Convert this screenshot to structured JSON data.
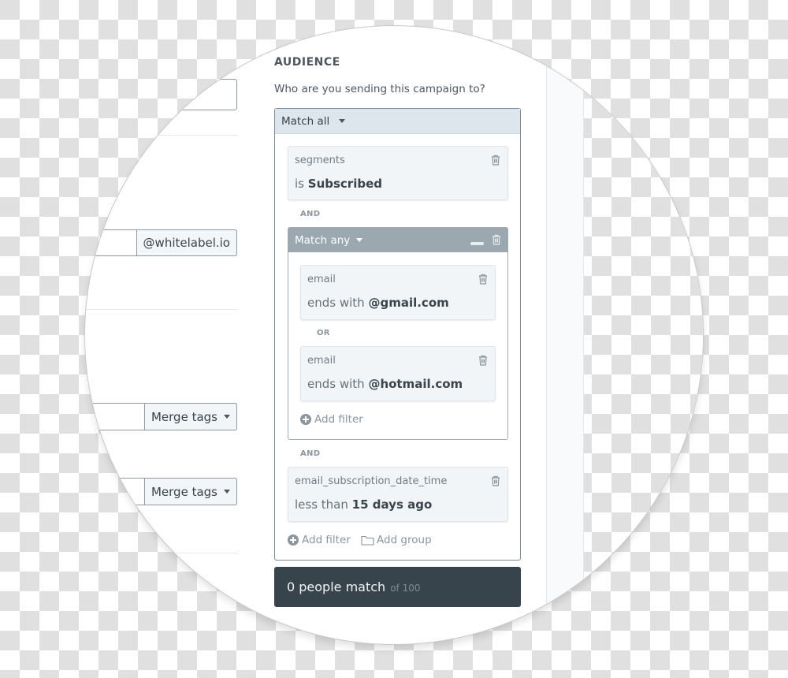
{
  "left_form": {
    "domain_addon": "@whitelabel.io",
    "merge_tags_label_1": "Merge tags",
    "merge_tags_label_2": "Merge tags"
  },
  "audience": {
    "title": "AUDIENCE",
    "subtitle": "Who are you sending this campaign to?",
    "match_mode": "Match all",
    "filters": [
      {
        "field": "segments",
        "operator": "is",
        "value": "Subscribed"
      }
    ],
    "conjunction_1": "AND",
    "group": {
      "match_mode": "Match any",
      "filters": [
        {
          "field": "email",
          "operator": "ends with",
          "value": "@gmail.com"
        },
        {
          "field": "email",
          "operator": "ends with",
          "value": "@hotmail.com"
        }
      ],
      "conjunction": "OR",
      "add_filter_label": "Add filter"
    },
    "conjunction_2": "AND",
    "date_filter": {
      "field": "email_subscription_date_time",
      "operator": "less than",
      "value": "15 days ago"
    },
    "add_filter_label": "Add filter",
    "add_group_label": "Add group"
  },
  "match_summary": {
    "count_text": "0 people match",
    "total_text": "of 100"
  },
  "colors": {
    "footer_bg": "#38444b",
    "group_header_bg": "#9ba8b0",
    "outer_header_bg": "#dde6ec",
    "card_bg": "#f1f5f8"
  }
}
